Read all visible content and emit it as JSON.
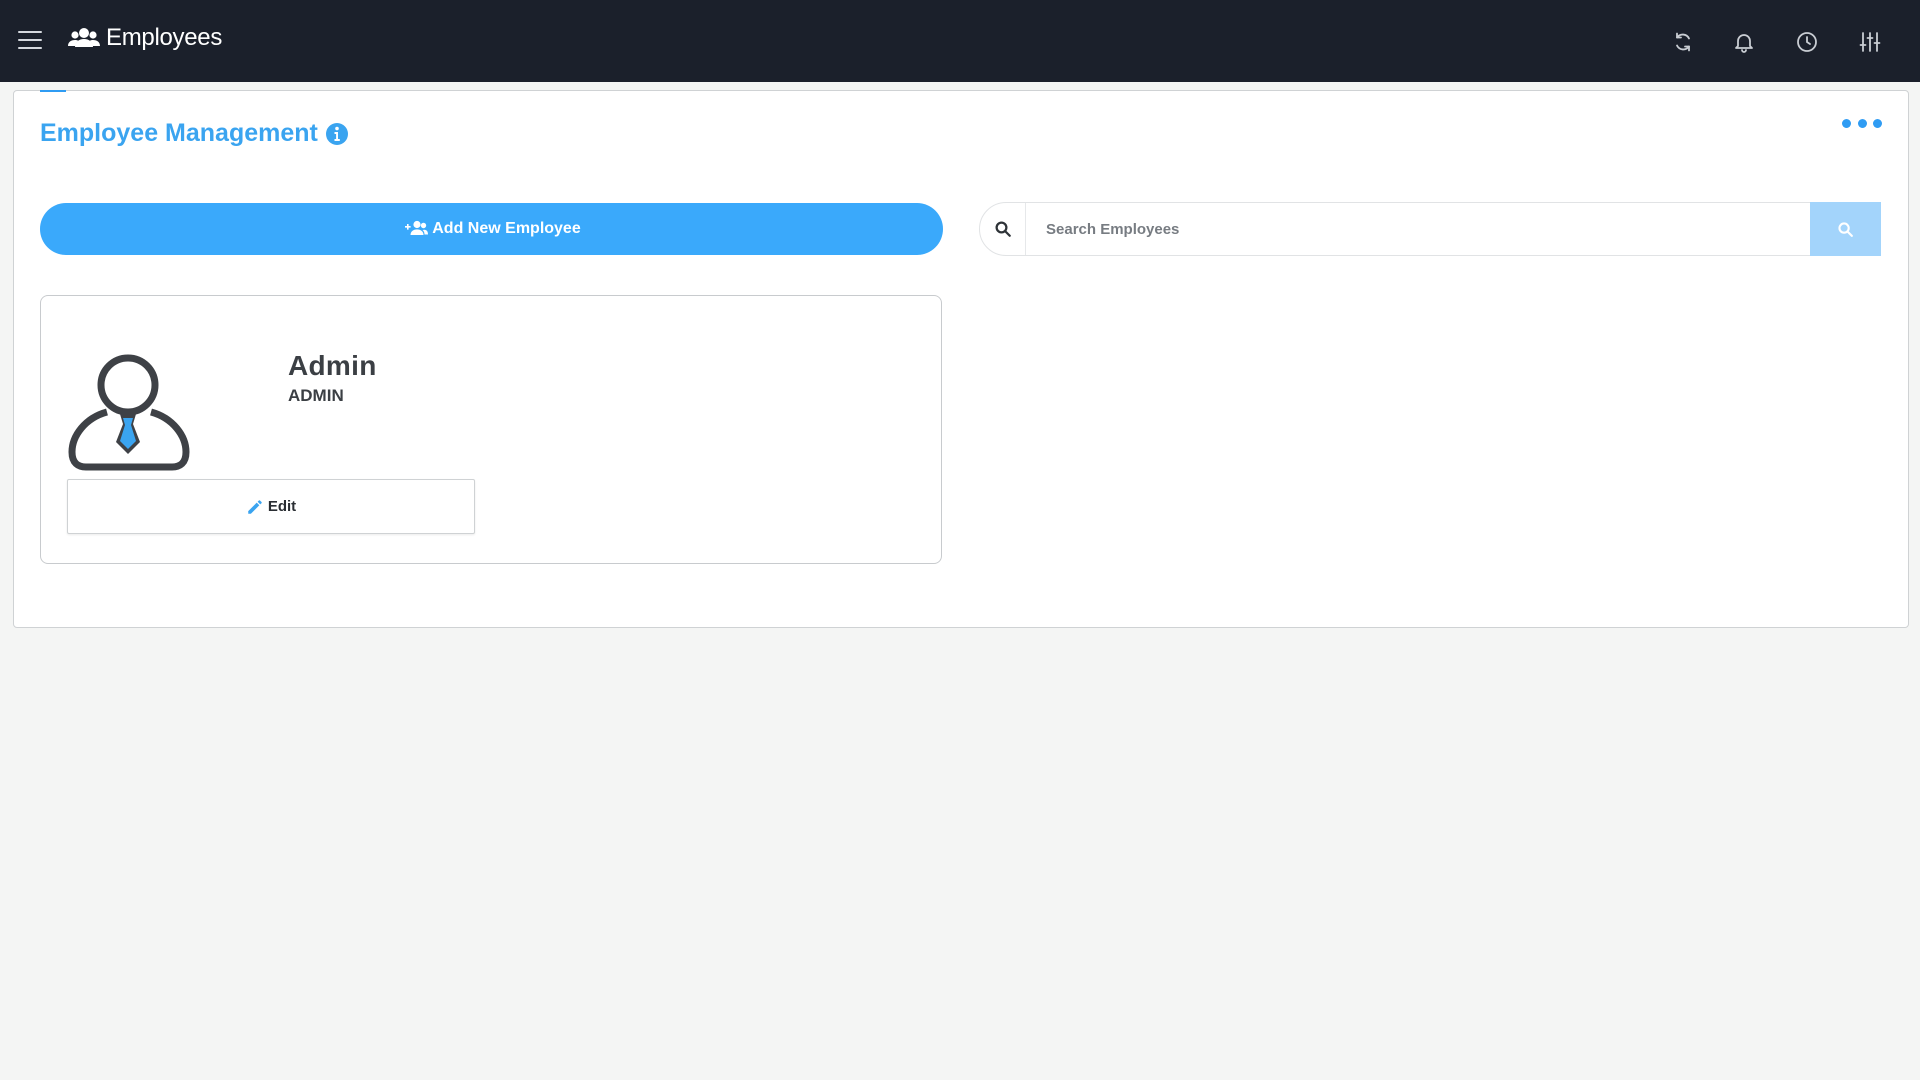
{
  "topbar": {
    "title": "Employees",
    "title_icon": "users-icon",
    "actions": [
      "refresh-icon",
      "bell-icon",
      "clock-icon",
      "sliders-icon"
    ]
  },
  "page": {
    "title": "Employee Management",
    "info_icon": "info-icon"
  },
  "toolbar": {
    "add_label": "Add New Employee",
    "search_placeholder": "Search Employees"
  },
  "employees": [
    {
      "name": "Admin",
      "role": "ADMIN",
      "edit_label": "Edit"
    }
  ],
  "colors": {
    "topbar_bg": "#1b202b",
    "accent": "#3aa9fb",
    "title": "#3aa4f0",
    "search_button": "#a3d4fb"
  }
}
